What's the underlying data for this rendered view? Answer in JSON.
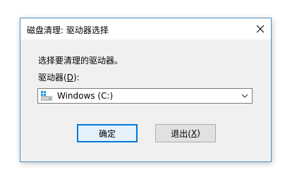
{
  "window": {
    "title": "磁盘清理: 驱动器选择"
  },
  "icons": {
    "close": "close-icon",
    "drive": "drive-icon",
    "dropdown": "chevron-down-icon"
  },
  "content": {
    "instruction": "选择要清理的驱动器。",
    "drive_label_prefix": "驱动器(",
    "drive_label_accel": "D",
    "drive_label_suffix": "):",
    "selected_drive": "Windows (C:)"
  },
  "buttons": {
    "ok_label": "确定",
    "exit_label_prefix": "退出(",
    "exit_label_accel": "X",
    "exit_label_suffix": ")"
  },
  "colors": {
    "accent": "#0078d7",
    "dialog_border": "#4a90c8",
    "dialog_bg": "#f0f0f0"
  }
}
